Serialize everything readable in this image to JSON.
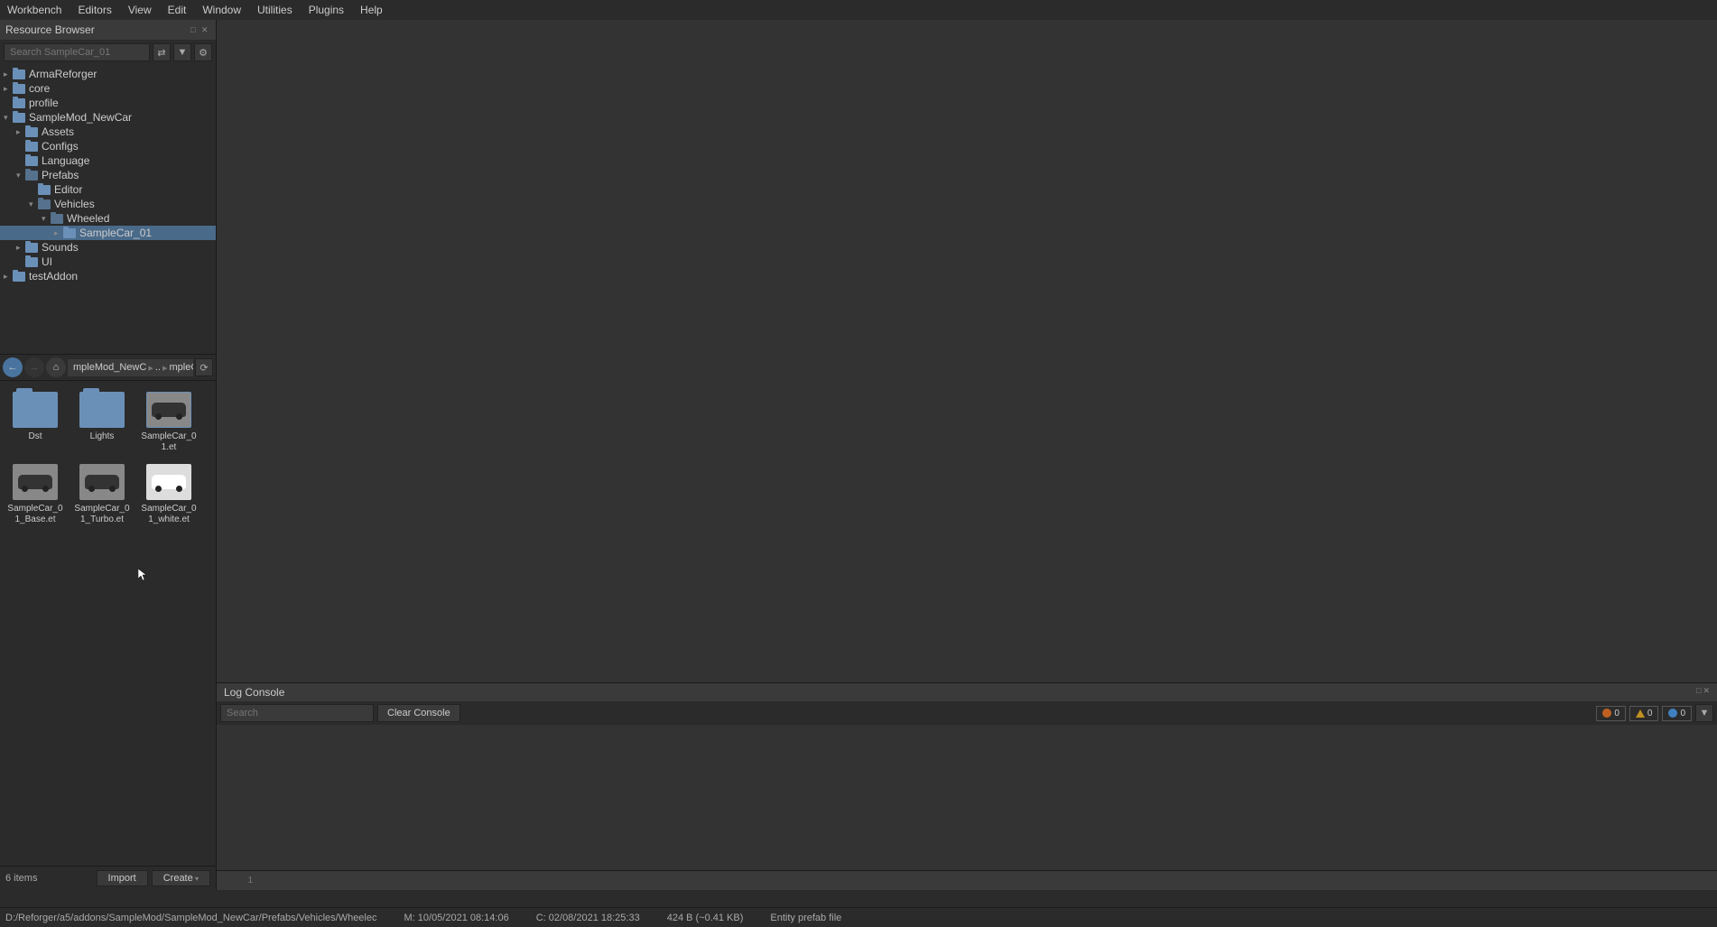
{
  "menubar": [
    "Workbench",
    "Editors",
    "View",
    "Edit",
    "Window",
    "Utilities",
    "Plugins",
    "Help"
  ],
  "panel": {
    "title": "Resource Browser",
    "search_placeholder": "Search SampleCar_01"
  },
  "tree": [
    {
      "indent": 0,
      "arrow": "closed",
      "label": "ArmaReforger",
      "icon": "folder"
    },
    {
      "indent": 0,
      "arrow": "closed",
      "label": "core",
      "icon": "folder"
    },
    {
      "indent": 0,
      "arrow": "none",
      "label": "profile",
      "icon": "folder"
    },
    {
      "indent": 0,
      "arrow": "open",
      "label": "SampleMod_NewCar",
      "icon": "folder"
    },
    {
      "indent": 1,
      "arrow": "closed",
      "label": "Assets",
      "icon": "folder"
    },
    {
      "indent": 1,
      "arrow": "none",
      "label": "Configs",
      "icon": "folder"
    },
    {
      "indent": 1,
      "arrow": "none",
      "label": "Language",
      "icon": "folder"
    },
    {
      "indent": 1,
      "arrow": "open",
      "label": "Prefabs",
      "icon": "folder-open"
    },
    {
      "indent": 2,
      "arrow": "none",
      "label": "Editor",
      "icon": "folder"
    },
    {
      "indent": 2,
      "arrow": "open",
      "label": "Vehicles",
      "icon": "folder-open"
    },
    {
      "indent": 3,
      "arrow": "open",
      "label": "Wheeled",
      "icon": "folder-open"
    },
    {
      "indent": 4,
      "arrow": "closed",
      "label": "SampleCar_01",
      "icon": "folder",
      "selected": true
    },
    {
      "indent": 1,
      "arrow": "closed",
      "label": "Sounds",
      "icon": "folder"
    },
    {
      "indent": 1,
      "arrow": "none",
      "label": "UI",
      "icon": "folder"
    },
    {
      "indent": 0,
      "arrow": "closed",
      "label": "testAddon",
      "icon": "folder"
    }
  ],
  "breadcrumb": {
    "part1": "mpleMod_NewC",
    "part2": "mpleCar_"
  },
  "files": [
    {
      "type": "folder",
      "label": "Dst"
    },
    {
      "type": "folder",
      "label": "Lights"
    },
    {
      "type": "car-dark",
      "label": "SampleCar_01.et",
      "selected": true
    },
    {
      "type": "car-dark",
      "label": "SampleCar_01_Base.et"
    },
    {
      "type": "car-dark",
      "label": "SampleCar_01_Turbo.et"
    },
    {
      "type": "car-white",
      "label": "SampleCar_01_white.et"
    }
  ],
  "footer": {
    "count": "6 items",
    "import": "Import",
    "create": "Create"
  },
  "log": {
    "title": "Log Console",
    "search_placeholder": "Search",
    "clear": "Clear Console",
    "err": "0",
    "warn": "0",
    "info": "0",
    "line": "1"
  },
  "status": {
    "path": "D:/Reforger/a5/addons/SampleMod/SampleMod_NewCar/Prefabs/Vehicles/Wheelec",
    "modified": "M: 10/05/2021 08:14:06",
    "created": "C: 02/08/2021 18:25:33",
    "size": "424 B (~0.41 KB)",
    "type": "Entity prefab file"
  }
}
